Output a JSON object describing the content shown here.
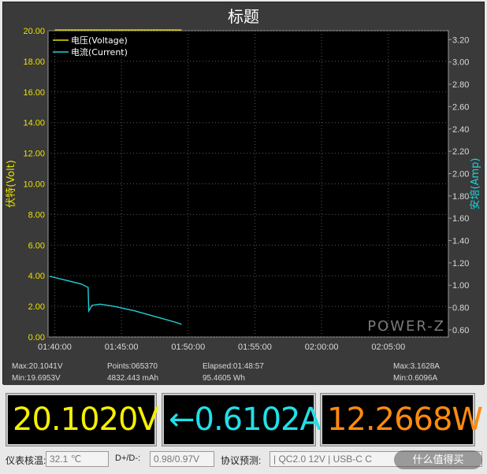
{
  "chart": {
    "title": "标题",
    "left_axis_label": "伏特(Volt)",
    "right_axis_label": "安培(Amp)",
    "watermark": "POWER-Z"
  },
  "chart_data": {
    "type": "line",
    "x_ticks": [
      "01:40:00",
      "01:45:00",
      "01:50:00",
      "01:55:00",
      "02:00:00",
      "02:05:00"
    ],
    "y_left_ticks": [
      "0.00",
      "2.00",
      "4.00",
      "6.00",
      "8.00",
      "10.00",
      "12.00",
      "14.00",
      "16.00",
      "18.00",
      "20.00"
    ],
    "y_right_ticks": [
      "0.60",
      "0.80",
      "1.00",
      "1.20",
      "1.40",
      "1.60",
      "1.80",
      "2.00",
      "2.20",
      "2.40",
      "2.60",
      "2.80",
      "3.00",
      "3.20"
    ],
    "ylim_left": [
      0,
      20
    ],
    "ylim_right": [
      0.536,
      3.28
    ],
    "xlim_minutes": [
      -0.5,
      29.5
    ],
    "series": [
      {
        "name": "电压(Voltage)",
        "axis": "left",
        "color": "#e8e000",
        "x_minutes": [
          0.0,
          9.5
        ],
        "values": [
          20.05,
          20.05
        ]
      },
      {
        "name": "电流(Current)",
        "axis": "right",
        "color": "#20d0d8",
        "x_minutes": [
          -0.4,
          1.0,
          2.0,
          2.5,
          2.55,
          2.8,
          3.4,
          4.5,
          6.0,
          7.5,
          9.0,
          9.5
        ],
        "values": [
          1.08,
          1.04,
          1.01,
          0.98,
          0.77,
          0.82,
          0.83,
          0.81,
          0.77,
          0.72,
          0.67,
          0.65
        ]
      }
    ],
    "grid": true,
    "legend": "top-left"
  },
  "stats": {
    "max_voltage": "Max:20.1041V",
    "min_voltage": "Min:19.6953V",
    "points": "Points:065370",
    "capacity": "4832.443 mAh",
    "elapsed": "Elapsed:01:48:57",
    "energy": "95.4605 Wh",
    "max_current": "Max:3.1628A",
    "min_current": "Min:0.6096A"
  },
  "readouts": {
    "voltage": "20.1020V",
    "current": "←0.6102A",
    "power": "12.2668W",
    "voltage_color": "#f5f000",
    "current_color": "#20e0e8",
    "power_color": "#ff8a10"
  },
  "statusbar": {
    "temp_label": "仪表核温:",
    "temp_value": "32.1 ℃",
    "dpdm_label": "D+/D-:",
    "dpdm_value": "0.98/0.97V",
    "protocol_label": "协议预测:",
    "protocol_value": "| QC2.0 12V | USB-C C"
  },
  "watermark_site": "什么值得买"
}
